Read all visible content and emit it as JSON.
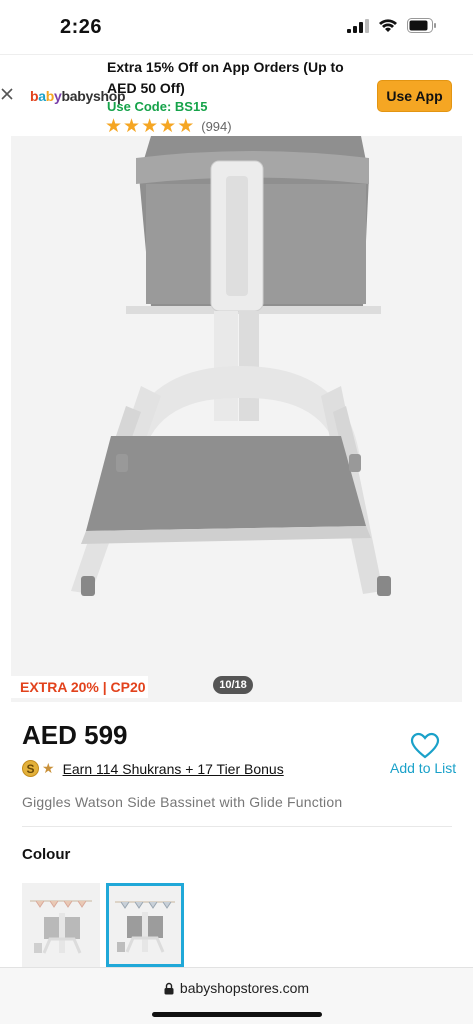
{
  "status_bar": {
    "time": "2:26"
  },
  "app_banner": {
    "logo_text": "babyshop",
    "title": "Extra 15% Off on App Orders (Up to AED 50 Off)",
    "code_text": "Use Code: BS15",
    "rating_count": "(994)",
    "rating_stars": 5,
    "button_label": "Use App",
    "accent_color": "#f5a623",
    "code_color": "#16a34a"
  },
  "gallery": {
    "promo_badge": "EXTRA 20% | CP20",
    "counter": "10/18"
  },
  "product": {
    "price": "AED 599",
    "shukran_coin": "S",
    "shukran_text": "Earn 114 Shukrans + 17 Tier Bonus",
    "wishlist_label": "Add to List",
    "name": "Giggles Watson Side Bassinet with Glide Function",
    "colour_label": "Colour",
    "accent_color": "#1aa1c9"
  },
  "browser": {
    "url": "babyshopstores.com"
  }
}
